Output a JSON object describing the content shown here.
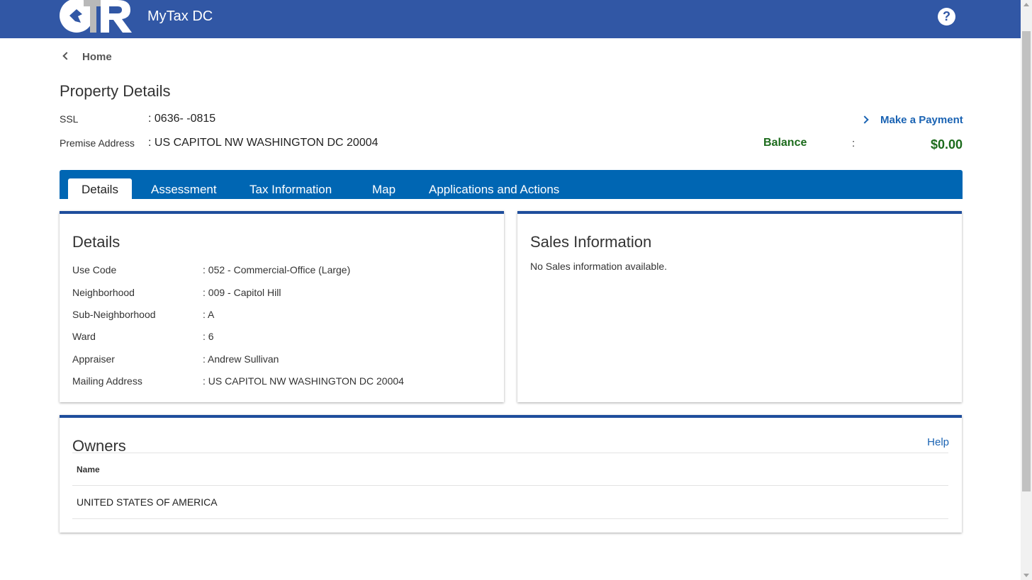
{
  "header": {
    "app_title": "MyTax DC",
    "help_glyph": "?",
    "logo_icon": "otr-logo-icon",
    "bg_color": "#3157a5"
  },
  "breadcrumb": {
    "label": "Home"
  },
  "page": {
    "title": "Property Details"
  },
  "property": {
    "ssl_label": "SSL",
    "ssl_value": ": 0636- -0815",
    "address_label": "Premise Address",
    "address_value": ": US CAPITOL NW WASHINGTON DC 20004"
  },
  "payment": {
    "link_label": "Make a Payment",
    "balance_label": "Balance",
    "balance_sep": ":",
    "balance_value": "$0.00",
    "balance_color": "#1c6b1c"
  },
  "tabs": [
    {
      "label": "Details",
      "active": true
    },
    {
      "label": "Assessment"
    },
    {
      "label": "Tax Information"
    },
    {
      "label": "Map"
    },
    {
      "label": "Applications and Actions"
    }
  ],
  "details": {
    "title": "Details",
    "rows": [
      {
        "label": "Use Code",
        "value": ": 052 - Commercial-Office (Large)"
      },
      {
        "label": "Neighborhood",
        "value": ": 009 - Capitol Hill"
      },
      {
        "label": "Sub-Neighborhood",
        "value": ": A"
      },
      {
        "label": "Ward",
        "value": ": 6"
      },
      {
        "label": "Appraiser",
        "value": ": Andrew Sullivan"
      },
      {
        "label": "Mailing Address",
        "value": ": US CAPITOL NW WASHINGTON DC 20004"
      }
    ]
  },
  "sales": {
    "title": "Sales Information",
    "message": "No Sales information available."
  },
  "owners": {
    "title": "Owners",
    "help_label": "Help",
    "column_name": "Name",
    "rows": [
      "UNITED STATES OF AMERICA"
    ]
  },
  "colors": {
    "tab_bar": "#0066b3",
    "card_border": "#1e4d9c",
    "link": "#1a63b3"
  }
}
